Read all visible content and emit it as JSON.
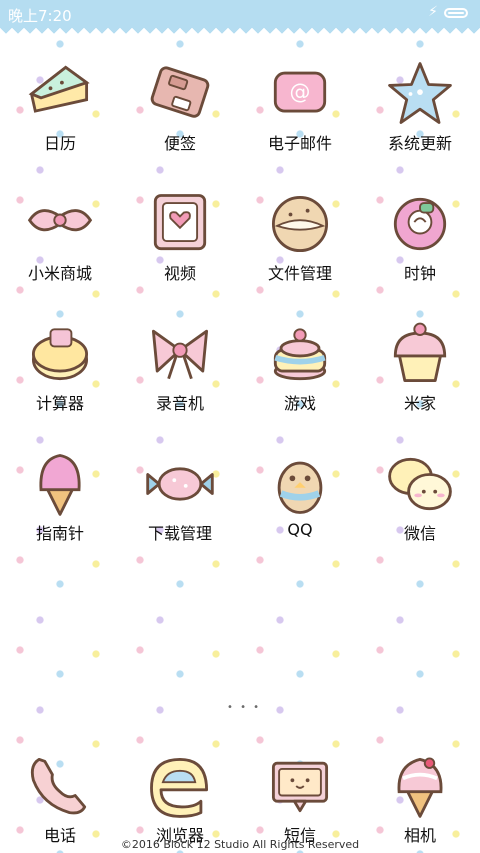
{
  "status_bar": {
    "time": "晚上7:20"
  },
  "apps": [
    {
      "label": "日历",
      "icon": "cake-slice-icon"
    },
    {
      "label": "便签",
      "icon": "chocolate-bar-icon"
    },
    {
      "label": "电子邮件",
      "icon": "email-pillow-icon"
    },
    {
      "label": "系统更新",
      "icon": "star-icon"
    },
    {
      "label": "小米商城",
      "icon": "bow-candy-icon"
    },
    {
      "label": "视频",
      "icon": "biscuit-heart-icon"
    },
    {
      "label": "文件管理",
      "icon": "cookie-sandwich-icon"
    },
    {
      "label": "时钟",
      "icon": "rose-donut-icon"
    },
    {
      "label": "计算器",
      "icon": "cake-roll-icon"
    },
    {
      "label": "录音机",
      "icon": "ribbon-bow-icon"
    },
    {
      "label": "游戏",
      "icon": "layer-cake-icon"
    },
    {
      "label": "米家",
      "icon": "cupcake-icon"
    },
    {
      "label": "指南针",
      "icon": "ice-cream-cone-icon"
    },
    {
      "label": "下载管理",
      "icon": "wrapped-candy-icon"
    },
    {
      "label": "QQ",
      "icon": "penguin-icon"
    },
    {
      "label": "微信",
      "icon": "chat-bubbles-icon"
    }
  ],
  "dock": [
    {
      "label": "电话",
      "icon": "phone-handset-icon"
    },
    {
      "label": "浏览器",
      "icon": "browser-e-icon"
    },
    {
      "label": "短信",
      "icon": "message-card-icon"
    },
    {
      "label": "相机",
      "icon": "ice-cream-icon"
    }
  ],
  "footer": "©2016 Block 12 Studio All Rights Reserved",
  "colors": {
    "status_bar": "#b5ddf1",
    "text": "#111111"
  }
}
